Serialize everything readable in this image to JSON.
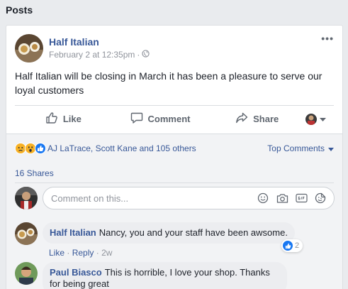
{
  "section": {
    "title": "Posts"
  },
  "post": {
    "author": "Half Italian",
    "timestamp": "February 2 at 12:35pm",
    "separator": "·",
    "privacy_icon": "globe-icon",
    "more_label": "•••",
    "text": "Half Italian will be closing in March it has been a pleasure to serve our loyal customers"
  },
  "actions": {
    "like": "Like",
    "comment": "Comment",
    "share": "Share"
  },
  "reactions": {
    "icons": [
      "sad-reaction-icon",
      "wow-reaction-icon",
      "like-reaction-icon"
    ],
    "summary": "AJ LaTrace, Scott Kane and 105 others",
    "sort_label": "Top Comments"
  },
  "shares": {
    "label": "16 Shares"
  },
  "composer": {
    "placeholder": "Comment on this...",
    "icons": [
      "emoji-icon",
      "camera-icon",
      "gif-icon",
      "sticker-icon"
    ]
  },
  "comments": [
    {
      "author": "Half Italian",
      "text": "Nancy, you and your staff have been awsome.",
      "like_label": "Like",
      "reply_label": "Reply",
      "dot": "·",
      "age": "2w",
      "like_count": "2"
    },
    {
      "author": "Paul Biasco",
      "text": "This is horrible, I love your shop. Thanks for being great"
    }
  ],
  "colors": {
    "link": "#385898",
    "like_blue": "#1877f2",
    "muted": "#90949c"
  }
}
